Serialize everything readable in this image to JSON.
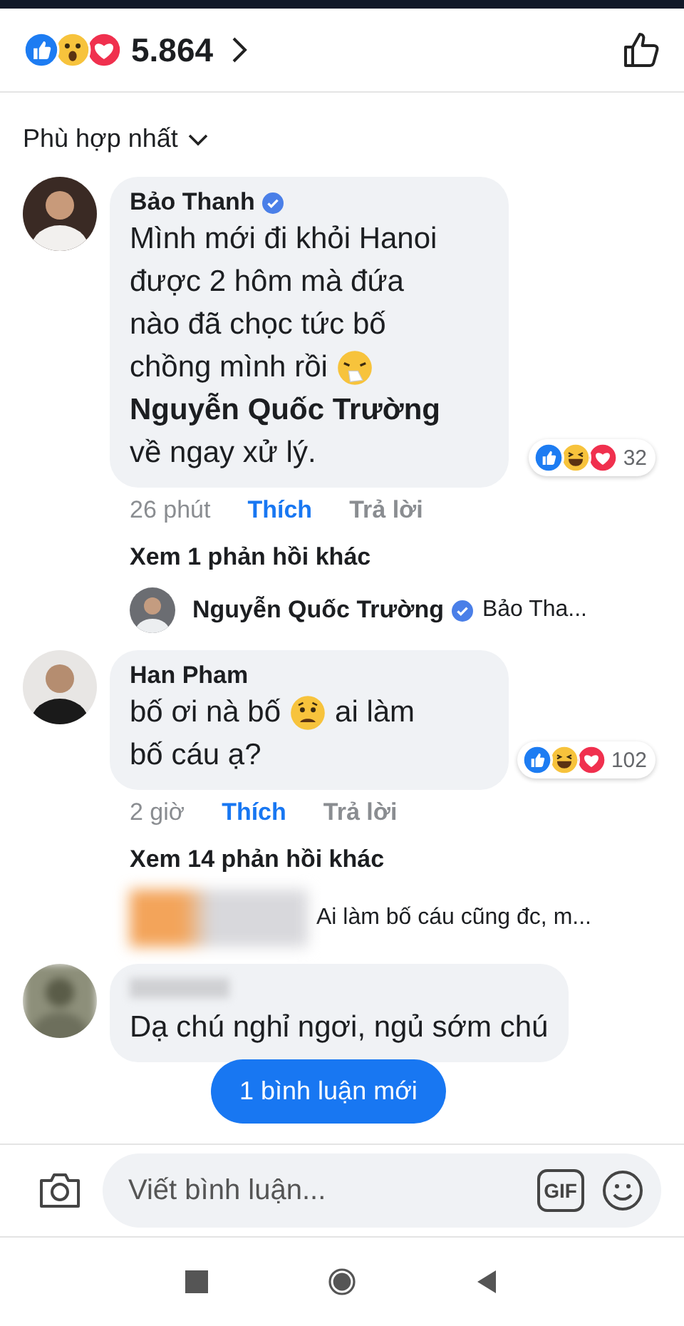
{
  "header": {
    "reactions": [
      {
        "kind": "like"
      },
      {
        "kind": "wow"
      },
      {
        "kind": "love"
      }
    ],
    "count": "5.864"
  },
  "sort": {
    "label": "Phù hợp nhất"
  },
  "comments": [
    {
      "author": "Bảo Thanh",
      "verified": true,
      "blurred": false,
      "lines": [
        [
          {
            "kind": "text",
            "text": "Mình mới đi khỏi Hanoi"
          }
        ],
        [
          {
            "kind": "text",
            "text": "được 2 hôm mà đứa"
          }
        ],
        [
          {
            "kind": "text",
            "text": "nào đã chọc tức bố"
          }
        ],
        [
          {
            "kind": "text",
            "text": "chồng mình rồi"
          },
          {
            "kind": "sneeze"
          }
        ],
        [
          {
            "kind": "mention",
            "text": "Nguyễn Quốc Trường"
          }
        ],
        [
          {
            "kind": "text",
            "text": "về ngay xử lý."
          }
        ]
      ],
      "reactions": {
        "kinds": [
          {
            "kind": "like"
          },
          {
            "kind": "haha"
          },
          {
            "kind": "love"
          }
        ],
        "count": "32"
      },
      "actions": {
        "time": "26 phút",
        "like": "Thích",
        "liked": true,
        "reply": "Trả lời"
      },
      "more_replies": "Xem 1 phản hồi khác",
      "reply_preview": {
        "author": "Nguyễn Quốc Trường",
        "verified": true,
        "blurred": false,
        "text": "Bảo Tha..."
      }
    },
    {
      "author": "Han Pham",
      "verified": false,
      "blurred": false,
      "lines": [
        [
          {
            "kind": "text",
            "text": "bố ơi nà bố"
          },
          {
            "kind": "worried"
          },
          {
            "kind": "text",
            "text": "ai làm"
          }
        ],
        [
          {
            "kind": "text",
            "text": "bố cáu ạ?"
          }
        ]
      ],
      "reactions": {
        "kinds": [
          {
            "kind": "like"
          },
          {
            "kind": "haha"
          },
          {
            "kind": "love"
          }
        ],
        "count": "102"
      },
      "actions": {
        "time": "2 giờ",
        "like": "Thích",
        "liked": true,
        "reply": "Trả lời"
      },
      "more_replies": "Xem 14 phản hồi khác",
      "reply_preview": {
        "blurred": true,
        "text": "Ai làm bố cáu cũng đc,  m..."
      }
    },
    {
      "blurred": true,
      "lines": [
        [
          {
            "kind": "text",
            "text": "Dạ chú nghỉ ngơi, ngủ sớm chú"
          }
        ]
      ]
    }
  ],
  "new_comments_pill": "1 bình luận mới",
  "composer": {
    "placeholder": "Viết bình luận...",
    "gif": "GIF"
  }
}
